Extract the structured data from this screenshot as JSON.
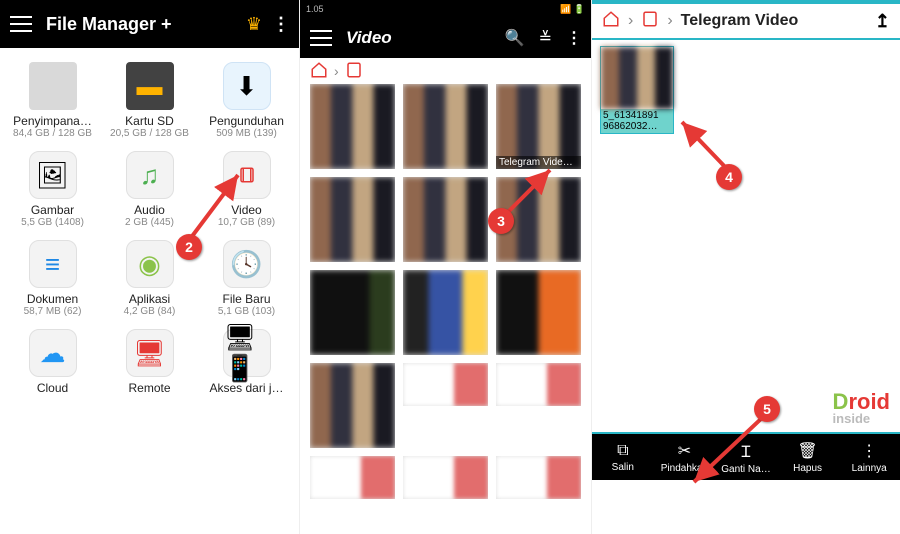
{
  "panel1": {
    "title": "File Manager +",
    "categories": [
      {
        "label": "Penyimpana…",
        "sub": "84,4 GB / 128 GB"
      },
      {
        "label": "Kartu SD",
        "sub": "20,5 GB / 128 GB"
      },
      {
        "label": "Pengunduhan",
        "sub": "509 MB (139)"
      },
      {
        "label": "Gambar",
        "sub": "5,5 GB (1408)"
      },
      {
        "label": "Audio",
        "sub": "2 GB (445)"
      },
      {
        "label": "Video",
        "sub": "10,7 GB (89)"
      },
      {
        "label": "Dokumen",
        "sub": "58,7 MB (62)"
      },
      {
        "label": "Aplikasi",
        "sub": "4,2 GB (84)"
      },
      {
        "label": "File Baru",
        "sub": "5,1 GB (103)"
      },
      {
        "label": "Cloud",
        "sub": ""
      },
      {
        "label": "Remote",
        "sub": ""
      },
      {
        "label": "Akses dari j…",
        "sub": ""
      }
    ]
  },
  "panel2": {
    "status_time": "1.05",
    "title": "Video",
    "telegram_label": "Telegram Video…"
  },
  "panel3": {
    "breadcrumb": "Telegram Video",
    "selected_filename_l1": "5_61341891",
    "selected_filename_l2": "96862032…",
    "toolbar": {
      "copy": "Salin",
      "move": "Pindahkan",
      "rename": "Ganti Na…",
      "delete": "Hapus",
      "more": "Lainnya"
    }
  },
  "watermark": {
    "brand": "roid",
    "sub": "inside"
  },
  "annotations": {
    "b2": "2",
    "b3": "3",
    "b4": "4",
    "b5": "5"
  }
}
